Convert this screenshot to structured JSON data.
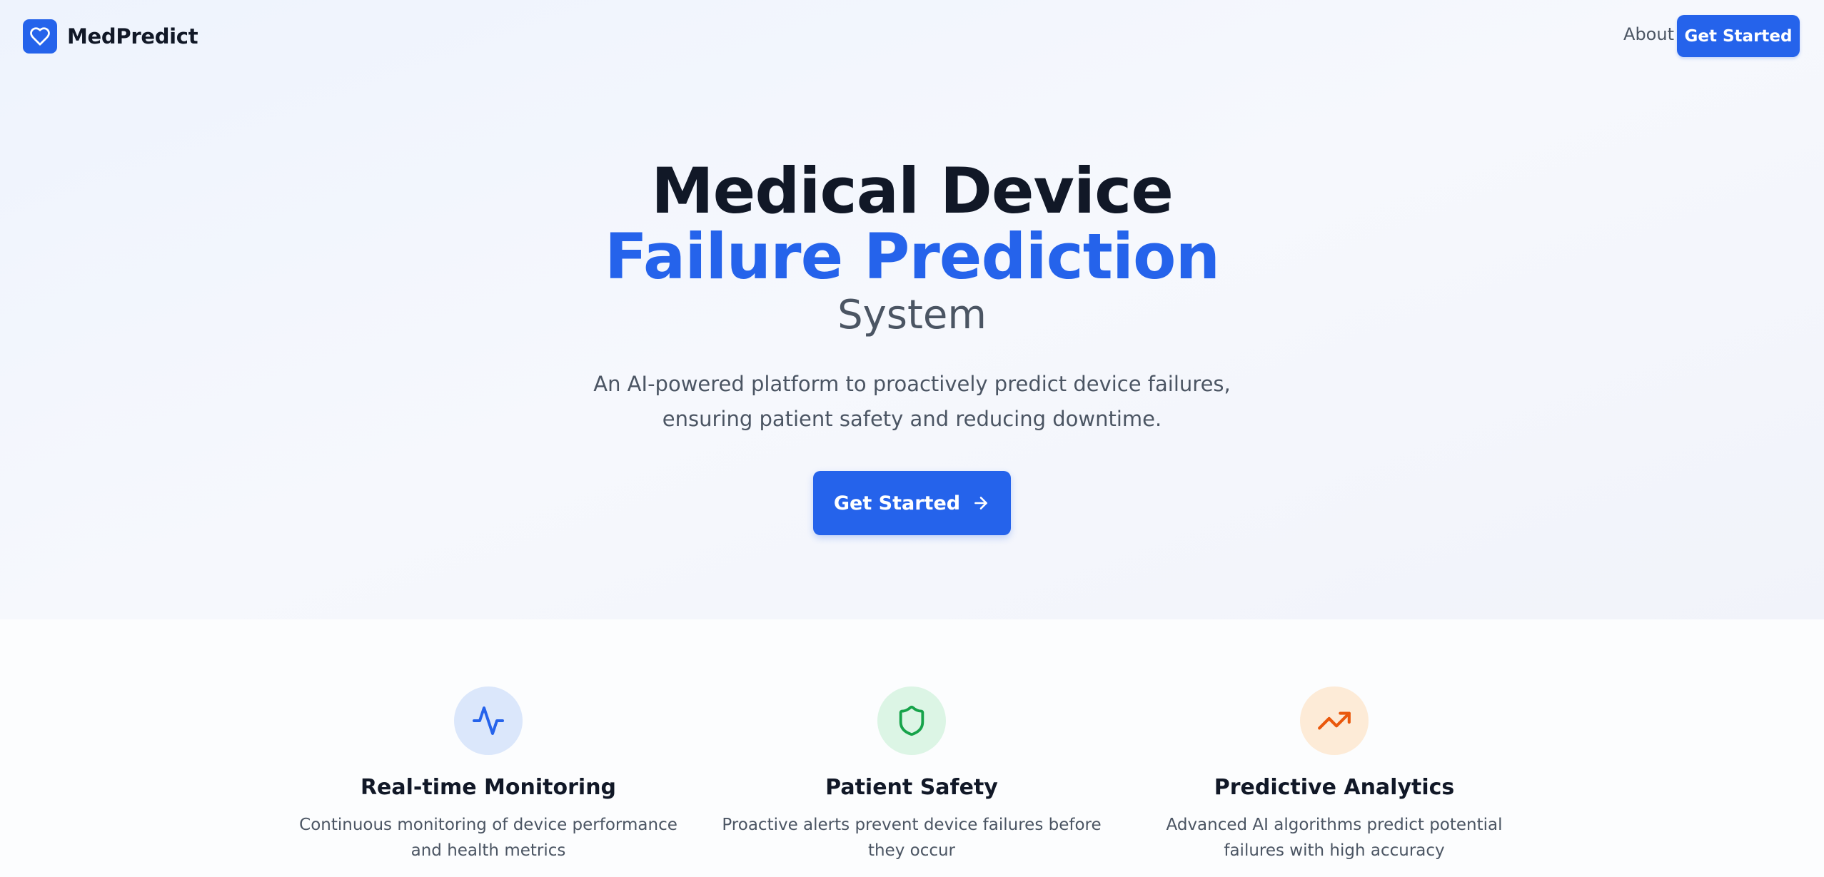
{
  "brand": {
    "name": "MedPredict",
    "icon": "heart-icon",
    "color": "#2563eb"
  },
  "nav": {
    "about": "About",
    "cta": "Get Started"
  },
  "hero": {
    "title_line1": "Medical Device",
    "title_line2": "Failure Prediction",
    "title_line3": "System",
    "subtitle": "An AI-powered platform to proactively predict device failures, ensuring patient safety and reducing downtime.",
    "cta": "Get Started",
    "cta_icon": "arrow-right-icon"
  },
  "features": [
    {
      "icon": "activity-icon",
      "title": "Real-time Monitoring",
      "description": "Continuous monitoring of device performance and health metrics",
      "icon_bg": "#dbe7fb",
      "icon_color": "#2563eb"
    },
    {
      "icon": "shield-icon",
      "title": "Patient Safety",
      "description": "Proactive alerts prevent device failures before they occur",
      "icon_bg": "#dcf5e5",
      "icon_color": "#16a34a"
    },
    {
      "icon": "trending-up-icon",
      "title": "Predictive Analytics",
      "description": "Advanced AI algorithms predict potential failures with high accuracy",
      "icon_bg": "#fdebd7",
      "icon_color": "#ea580c"
    }
  ]
}
